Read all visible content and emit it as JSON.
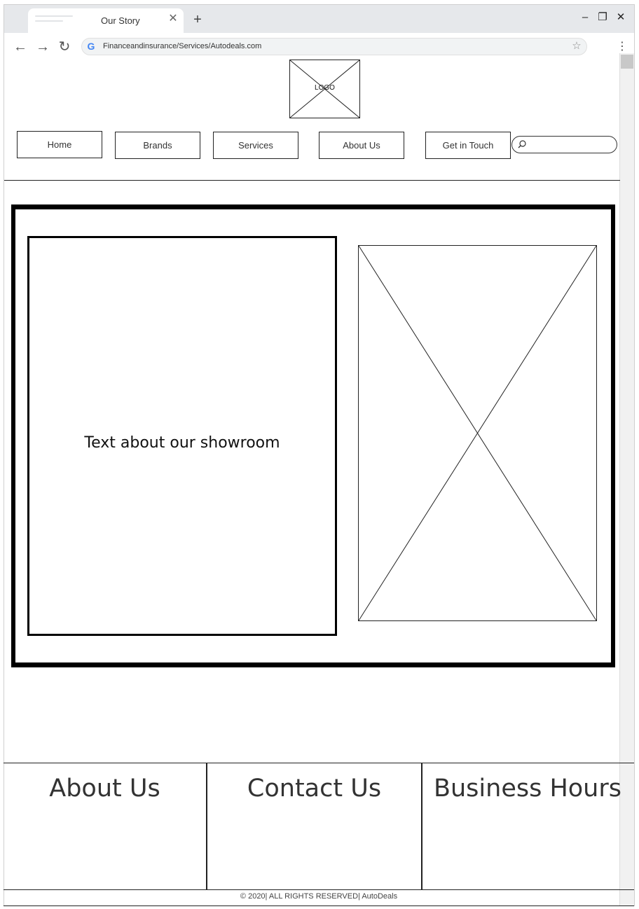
{
  "browser": {
    "tab_title": "Our Story",
    "url": "Financeandinsurance/Services/Autodeals.com",
    "icons": {
      "back": "arrow-left-icon",
      "forward": "arrow-right-icon",
      "reload": "reload-icon",
      "google": "google-icon",
      "star": "star-icon",
      "menu": "kebab-menu-icon",
      "minimize": "minimize-icon",
      "restore": "restore-icon",
      "close": "close-icon",
      "new_tab": "plus-icon",
      "tab_close": "close-icon"
    }
  },
  "header": {
    "logo_label": "LOGO",
    "nav": [
      "Home",
      "Brands",
      "Services",
      "About Us",
      "Get in Touch"
    ],
    "search": {
      "placeholder": "",
      "value": "",
      "icon": "search-icon"
    }
  },
  "main": {
    "text_panel": "Text about our showroom",
    "image_placeholder": "image-placeholder"
  },
  "footer": {
    "columns": [
      "About Us",
      "Contact Us",
      "Business Hours"
    ],
    "copyright": "© 2020| ALL RIGHTS RESERVED| AutoDeals"
  },
  "colors": {
    "chrome_bg": "#e6e8eb",
    "stroke": "#000000",
    "text": "#222222"
  }
}
